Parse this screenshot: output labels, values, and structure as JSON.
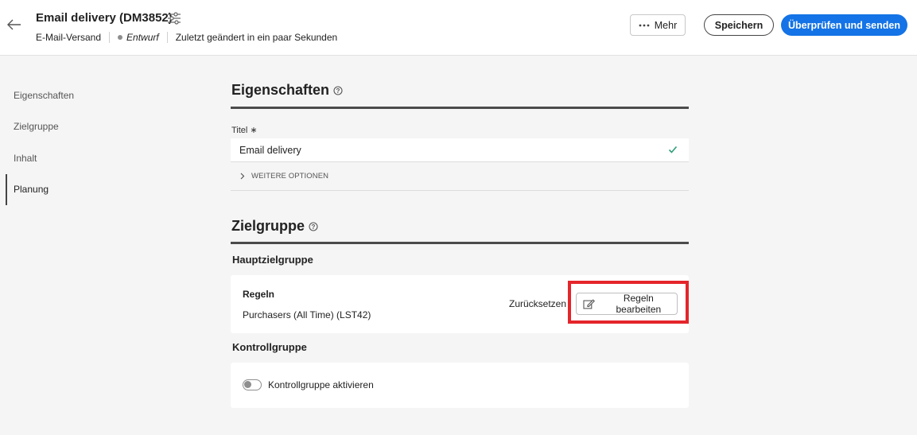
{
  "header": {
    "title": "Email delivery (DM3852)",
    "type_label": "E-Mail-Versand",
    "status": "Entwurf",
    "modified": "Zuletzt geändert in ein paar Sekunden",
    "more_label": "Mehr",
    "save_label": "Speichern",
    "send_label": "Überprüfen und senden",
    "icons": {
      "back": "arrow-left-icon",
      "settings": "sliders-icon",
      "more": "ellipsis-icon"
    }
  },
  "sidebar": {
    "items": [
      {
        "label": "Eigenschaften",
        "active": false
      },
      {
        "label": "Zielgruppe",
        "active": false
      },
      {
        "label": "Inhalt",
        "active": false
      },
      {
        "label": "Planung",
        "active": true
      }
    ]
  },
  "properties": {
    "heading": "Eigenschaften",
    "title_label": "Titel ∗",
    "title_value": "Email delivery",
    "more_options": "WEITERE OPTIONEN"
  },
  "audience": {
    "heading": "Zielgruppe",
    "main_heading": "Hauptzielgruppe",
    "rules_label": "Regeln",
    "rules_value": "Purchasers (All Time) (LST42)",
    "reset_label": "Zurücksetzen",
    "edit_label": "Regeln bearbeiten",
    "control_heading": "Kontrollgruppe",
    "control_toggle_label": "Kontrollgruppe aktivieren",
    "control_enabled": false
  },
  "colors": {
    "accent": "#1473e6",
    "highlight": "#e4252b",
    "check": "#2d9d78"
  }
}
